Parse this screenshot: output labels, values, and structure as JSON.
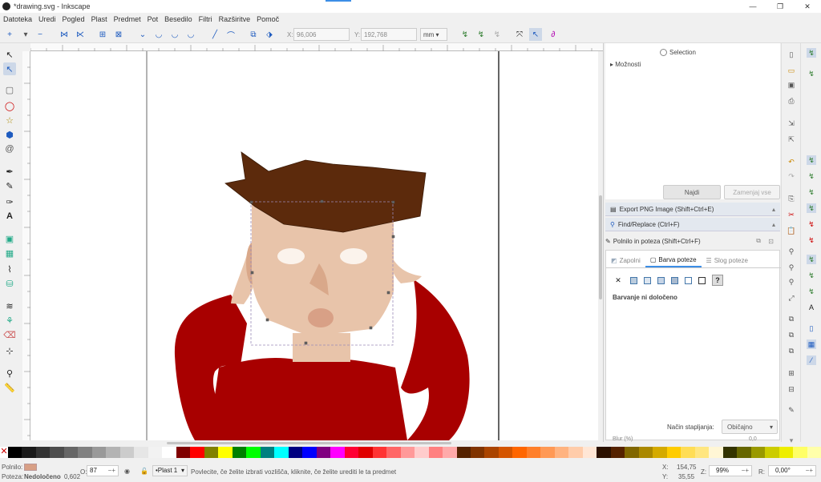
{
  "window": {
    "title": "*drawing.svg - Inkscape",
    "controls": [
      "—",
      "❐",
      "✕"
    ]
  },
  "menu": [
    "Datoteka",
    "Uredi",
    "Pogled",
    "Plast",
    "Predmet",
    "Pot",
    "Besedilo",
    "Filtri",
    "Razširitve",
    "Pomoč"
  ],
  "toolbar": {
    "x_label": "X:",
    "x_value": "96,006",
    "y_label": "Y:",
    "y_value": "192,768",
    "unit": "mm"
  },
  "dock": {
    "selection_label": "Selection",
    "moznosti": "▸ Možnosti",
    "najdi": "Najdi",
    "zamenjaj": "Zamenjaj vse",
    "export_header": "Export PNG Image (Shift+Ctrl+E)",
    "find_header": "Find/Replace (Ctrl+F)",
    "fill_header": "Polnilo in poteza  (Shift+Ctrl+F)",
    "tab_fill": "Zapolni",
    "tab_stroke_paint": "Barva poteze",
    "tab_stroke_style": "Slog poteze",
    "no_paint": "Barvanje ni določeno",
    "blend_label": "Način stapljanja:",
    "blend_value": "Običajno",
    "blur_label": "Blur (%)",
    "blur_value": "0,0"
  },
  "palette_colors": [
    "#000000",
    "#1a1a1a",
    "#333333",
    "#4d4d4d",
    "#666666",
    "#808080",
    "#999999",
    "#b3b3b3",
    "#cccccc",
    "#e6e6e6",
    "#f2f2f2",
    "#ffffff",
    "#800000",
    "#ff0000",
    "#808000",
    "#ffff00",
    "#008000",
    "#00ff00",
    "#008080",
    "#00ffff",
    "#000080",
    "#0000ff",
    "#800080",
    "#ff00ff",
    "#ff0033",
    "#e00000",
    "#ff3333",
    "#ff6666",
    "#ff9999",
    "#ffcccc",
    "#ff8080",
    "#ffaaaa",
    "#552200",
    "#803300",
    "#aa4400",
    "#d45500",
    "#ff6600",
    "#ff7f2a",
    "#ff9955",
    "#ffb380",
    "#ffccaa",
    "#ffe6d5",
    "#2b1100",
    "#552200",
    "#806600",
    "#aa8800",
    "#d4aa00",
    "#ffcc00",
    "#ffdd55",
    "#ffe680",
    "#fff6d5",
    "#333300",
    "#666600",
    "#999900",
    "#cccc00",
    "#eeee00",
    "#ffff66",
    "#ffffaa"
  ],
  "status": {
    "fill_label": "Polnilo:",
    "stroke_label": "Poteza:",
    "stroke_value": "Nedoločeno",
    "stroke_width": "0,602",
    "opacity_label": "O:",
    "opacity_value": "87",
    "layer": "•Plast 1",
    "message": "Povlecite, če želite izbrati vozlišča, kliknite, če želite urediti le ta predmet",
    "x_label": "X:",
    "x_value": "154,75",
    "y_label": "Y:",
    "y_value": "35,55",
    "zoom_label": "Z:",
    "zoom_value": "99%",
    "rot_label": "R:",
    "rot_value": "0,00°"
  },
  "colors": {
    "hair": "#5c2a0c",
    "skin": "#e8c4aa",
    "skin_dark": "#d9a88a",
    "mouth": "#d8a086",
    "shirt": "#a80000",
    "eye": "#fbf3ec"
  }
}
